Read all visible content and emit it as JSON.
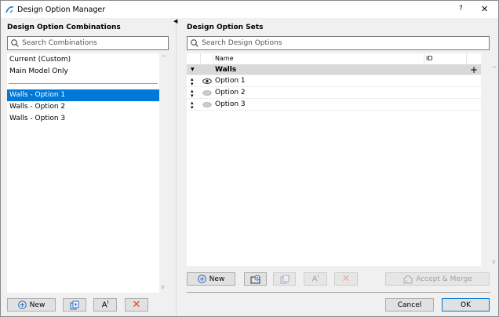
{
  "window": {
    "title": "Design Option Manager",
    "help": "?",
    "close": "✕"
  },
  "left": {
    "heading": "Design Option Combinations",
    "search_placeholder": "Search Combinations",
    "items": [
      {
        "label": "Current (Custom)"
      },
      {
        "label": "Main Model Only"
      },
      {
        "label": "Walls - Option 1"
      },
      {
        "label": "Walls - Option 2"
      },
      {
        "label": "Walls - Option 3"
      }
    ],
    "new_label": "New"
  },
  "right": {
    "heading": "Design Option Sets",
    "search_placeholder": "Search Design Options",
    "columns": {
      "name": "Name",
      "id": "ID"
    },
    "set": {
      "name": "Walls"
    },
    "options": [
      {
        "name": "Option 1",
        "visible": true
      },
      {
        "name": "Option 2",
        "visible": false
      },
      {
        "name": "Option 3",
        "visible": false
      }
    ],
    "new_label": "New",
    "accept_label": "Accept & Merge"
  },
  "footer": {
    "cancel": "Cancel",
    "ok": "OK"
  },
  "colors": {
    "selection": "#0078d7",
    "delete": "#e8402a"
  }
}
